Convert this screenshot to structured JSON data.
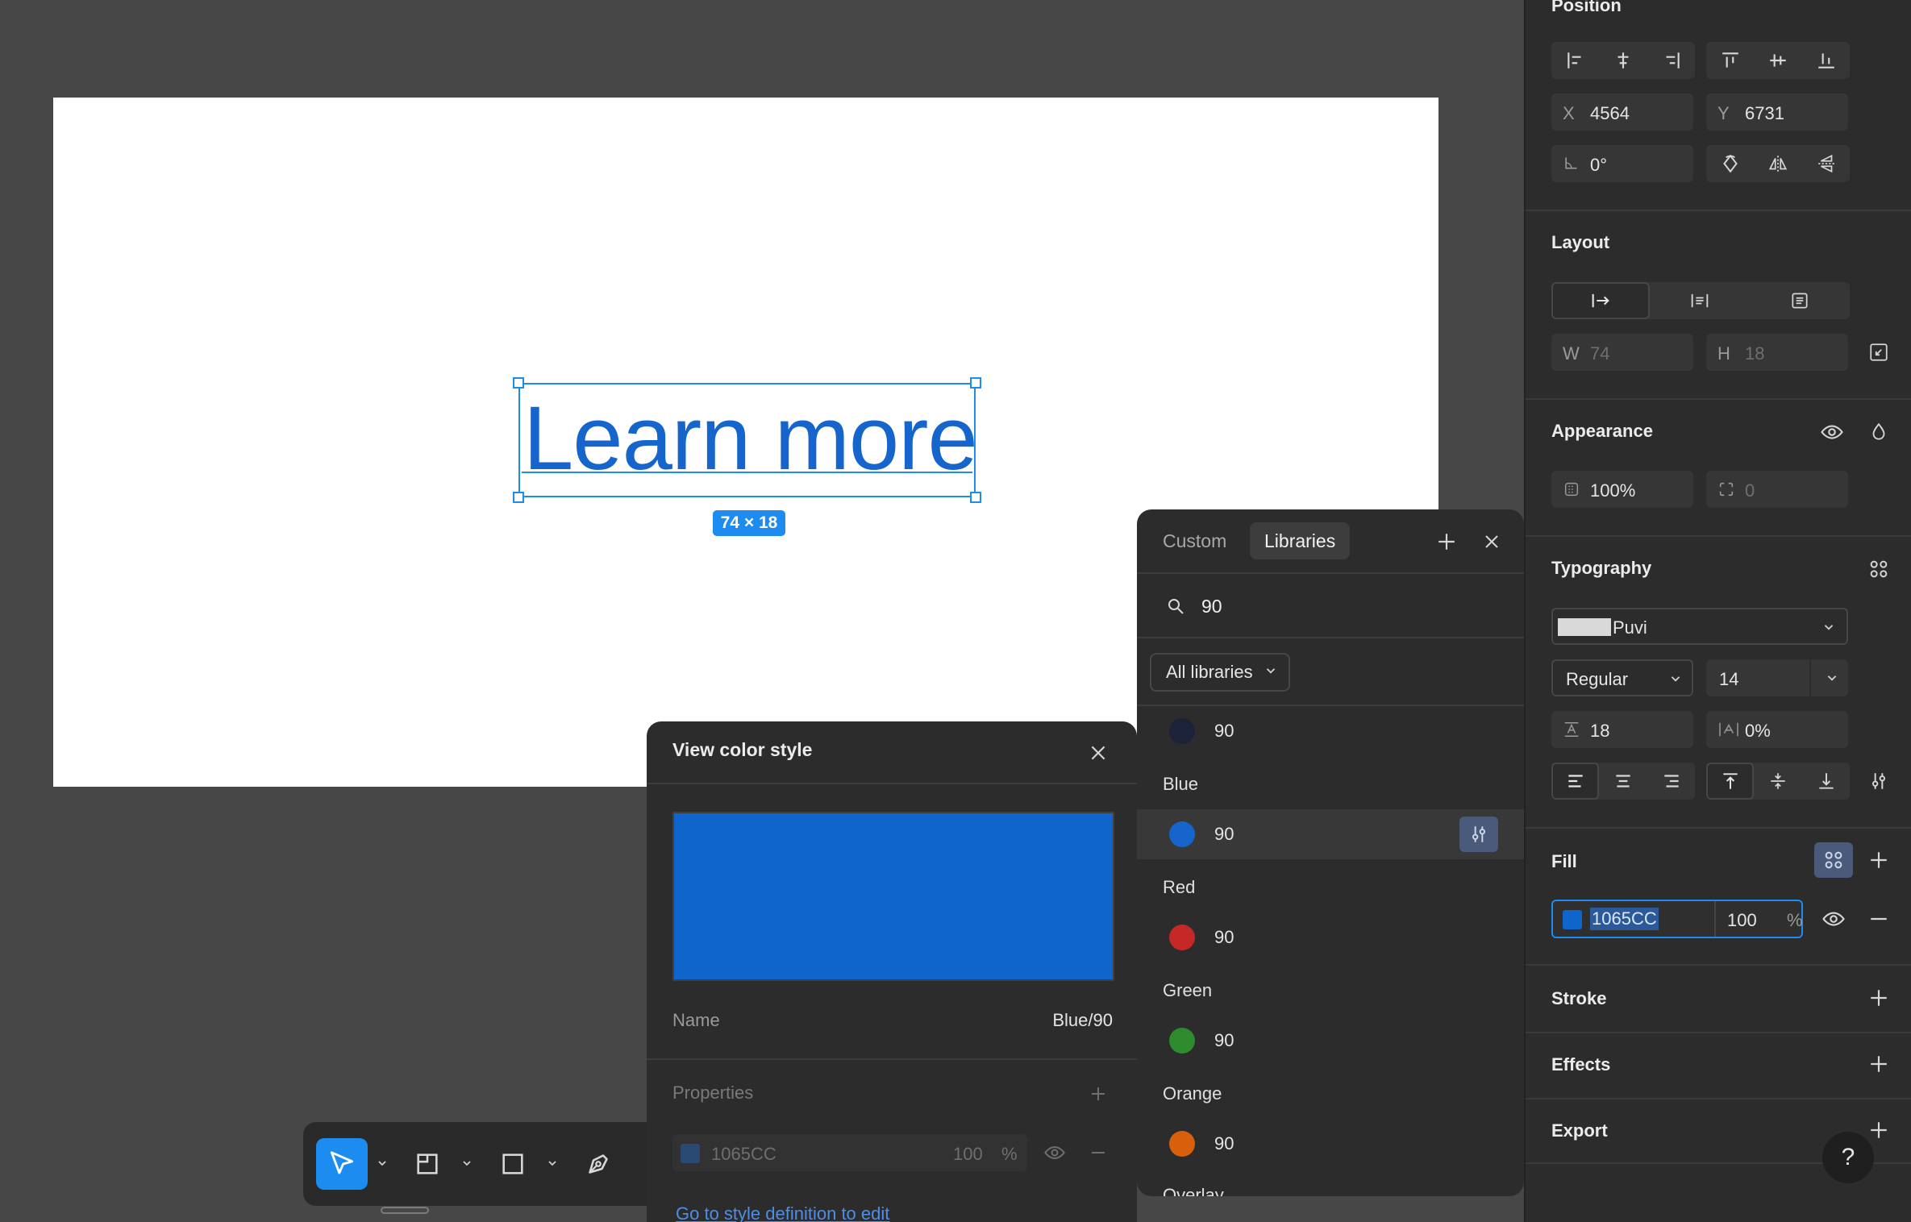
{
  "canvas": {
    "text_content": "Learn more",
    "size_badge": "74 × 18"
  },
  "color_style_panel": {
    "title": "View color style",
    "swatch_color": "#1065CC",
    "name_label": "Name",
    "name_value": "Blue/90",
    "properties_label": "Properties",
    "prop_hex": "1065CC",
    "prop_opacity": "100",
    "prop_percent": "%",
    "link_text": "Go to style definition to edit"
  },
  "picker": {
    "tabs": [
      "Custom",
      "Libraries"
    ],
    "search_value": "90",
    "library_filter": "All libraries",
    "items": [
      {
        "group": "",
        "label": "90",
        "color": "#1c2238"
      },
      {
        "group": "Blue",
        "label": "90",
        "color": "#1565cc",
        "highlighted": true
      },
      {
        "group": "Red",
        "label": "90",
        "color": "#c62828"
      },
      {
        "group": "Green",
        "label": "90",
        "color": "#2e8b2e"
      },
      {
        "group": "Orange",
        "label": "90",
        "color": "#d9600b"
      }
    ],
    "next_group": "Overlay"
  },
  "panel": {
    "position": {
      "title": "Position",
      "x_label": "X",
      "x_value": "4564",
      "y_label": "Y",
      "y_value": "6731",
      "rotation": "0°"
    },
    "layout": {
      "title": "Layout",
      "w_label": "W",
      "w_value": "74",
      "h_label": "H",
      "h_value": "18"
    },
    "appearance": {
      "title": "Appearance",
      "opacity": "100%",
      "radius": "0"
    },
    "typography": {
      "title": "Typography",
      "font": "Puvi",
      "weight": "Regular",
      "size": "14",
      "line_height": "18",
      "letter_spacing": "0%"
    },
    "fill": {
      "title": "Fill",
      "hex": "1065CC",
      "opacity": "100",
      "percent": "%",
      "color": "#1065CC"
    },
    "stroke_title": "Stroke",
    "effects_title": "Effects",
    "export_title": "Export",
    "help": "?"
  }
}
